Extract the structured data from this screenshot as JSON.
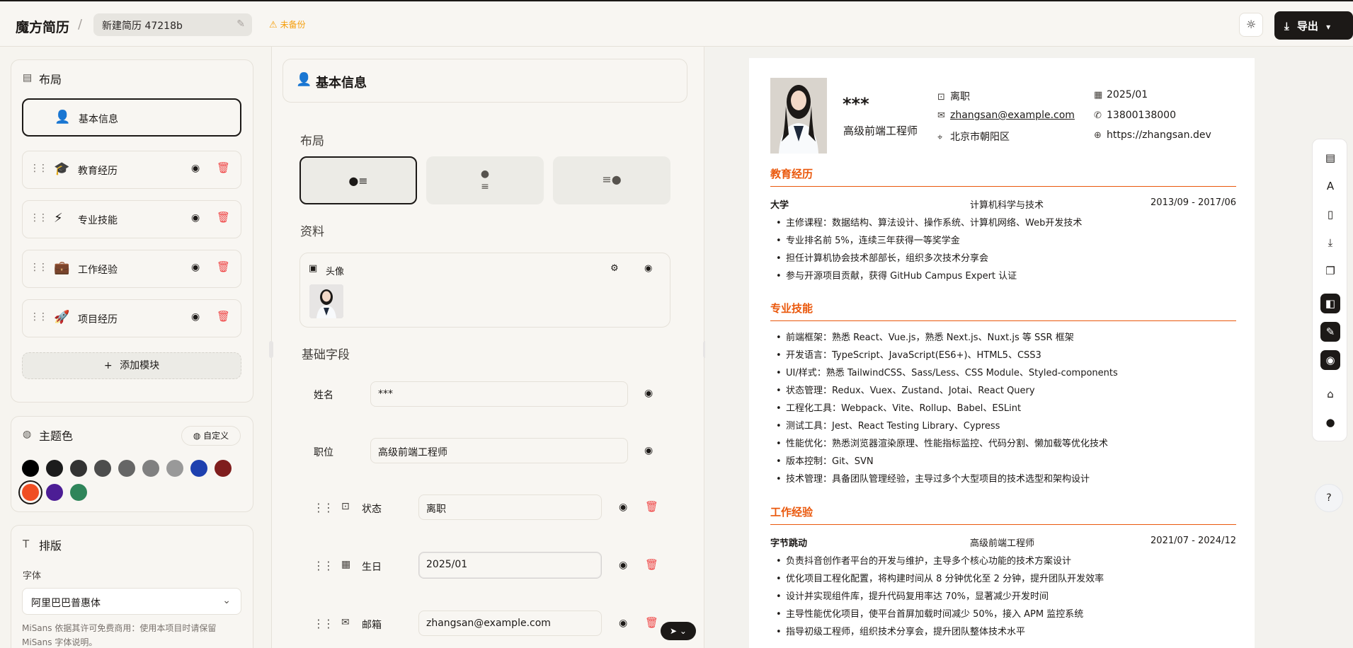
{
  "header": {
    "brand": "魔方简历",
    "separator": "/",
    "resume_title": "新建简历 47218b",
    "backup_status": "未备份",
    "export_label": "导出"
  },
  "sidebar": {
    "layout_title": "布局",
    "sections": [
      {
        "label": "基本信息",
        "icon": "user-icon"
      },
      {
        "label": "教育经历",
        "icon": "graduation-cap-icon"
      },
      {
        "label": "专业技能",
        "icon": "lightning-icon"
      },
      {
        "label": "工作经验",
        "icon": "briefcase-icon"
      },
      {
        "label": "项目经历",
        "icon": "rocket-icon"
      }
    ],
    "add_module_label": "添加模块",
    "theme_title": "主题色",
    "custom_label": "自定义",
    "theme_colors": [
      "#000000",
      "#1c1c1c",
      "#333333",
      "#4d4d4d",
      "#666666",
      "#808080",
      "#999999",
      "#1e40af",
      "#7f1d1d",
      "#f04e23",
      "#4c1d95",
      "#2f855a"
    ],
    "selected_color": "#f04e23",
    "typography_title": "排版",
    "font_label": "字体",
    "font_value": "阿里巴巴普惠体",
    "font_note": "MiSans 依据其许可免费商用：使用本项目时请保留 MiSans 字体说明。"
  },
  "editor": {
    "title": "基本信息",
    "layout_label": "布局",
    "layout_options": [
      "●≡",
      "●≡",
      "≡●"
    ],
    "profile_label": "资料",
    "avatar_label": "头像",
    "basic_fields_label": "基础字段",
    "fields": {
      "name": {
        "label": "姓名",
        "value": "***"
      },
      "position": {
        "label": "职位",
        "value": "高级前端工程师"
      },
      "status": {
        "label": "状态",
        "value": "离职"
      },
      "birthday": {
        "label": "生日",
        "value": "2025/01"
      },
      "email": {
        "label": "邮箱",
        "value": "zhangsan@example.com"
      }
    }
  },
  "resume": {
    "name": "***",
    "title": "高级前端工程师",
    "status": "离职",
    "birthday": "2025/01",
    "email": "zhangsan@example.com",
    "phone": "13800138000",
    "location": "北京市朝阳区",
    "website": "https://zhangsan.dev",
    "education": {
      "heading": "教育经历",
      "school": "大学",
      "major": "计算机科学与技术",
      "period": "2013/09 - 2017/06",
      "bullets": [
        "主修课程：数据结构、算法设计、操作系统、计算机网络、Web开发技术",
        "专业排名前 5%，连续三年获得一等奖学金",
        "担任计算机协会技术部部长，组织多次技术分享会",
        "参与开源项目贡献，获得 GitHub Campus Expert 认证"
      ]
    },
    "skills": {
      "heading": "专业技能",
      "bullets": [
        "前端框架：熟悉 React、Vue.js，熟悉 Next.js、Nuxt.js 等 SSR 框架",
        "开发语言：TypeScript、JavaScript(ES6+)、HTML5、CSS3",
        "UI/样式：熟悉 TailwindCSS、Sass/Less、CSS Module、Styled-components",
        "状态管理：Redux、Vuex、Zustand、Jotai、React Query",
        "工程化工具：Webpack、Vite、Rollup、Babel、ESLint",
        "测试工具：Jest、React Testing Library、Cypress",
        "性能优化：熟悉浏览器渲染原理、性能指标监控、代码分割、懒加载等优化技术",
        "版本控制：Git、SVN",
        "技术管理：具备团队管理经验，主导过多个大型项目的技术选型和架构设计"
      ]
    },
    "work": {
      "heading": "工作经验",
      "company": "字节跳动",
      "role": "高级前端工程师",
      "period": "2021/07 - 2024/12",
      "bullets": [
        "负责抖音创作者平台的开发与维护，主导多个核心功能的技术方案设计",
        "优化项目工程化配置，将构建时间从 8 分钟优化至 2 分钟，提升团队开发效率",
        "设计并实现组件库，提升代码复用率达 70%，显著减少开发时间",
        "主导性能优化项目，使平台首屏加载时间减少 50%，接入 APM 监控系统",
        "指导初级工程师，组织技术分享会，提升团队整体技术水平"
      ]
    }
  }
}
